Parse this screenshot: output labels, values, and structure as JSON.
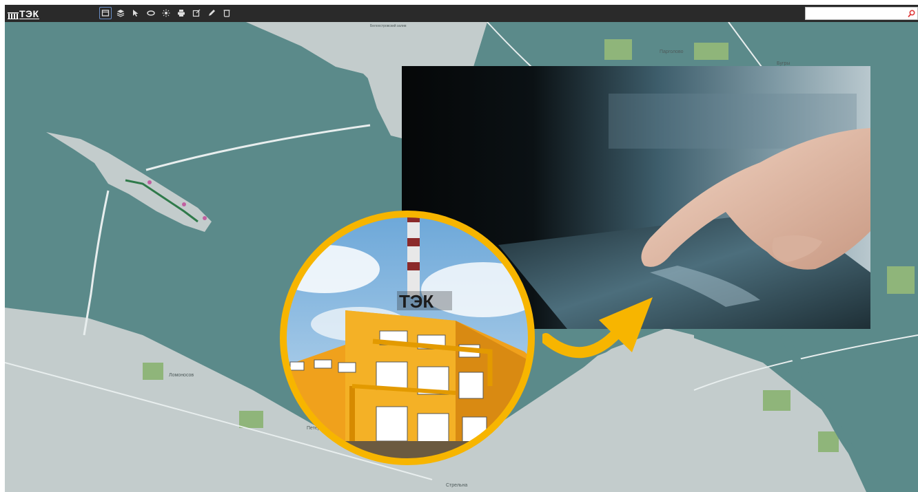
{
  "app": {
    "logo_text": "ТЭК"
  },
  "toolbar": {
    "tools": [
      {
        "name": "map-view",
        "active": true
      },
      {
        "name": "layers"
      },
      {
        "name": "select"
      },
      {
        "name": "measure"
      },
      {
        "name": "settings"
      },
      {
        "name": "print"
      },
      {
        "name": "export"
      },
      {
        "name": "draw"
      },
      {
        "name": "delete"
      }
    ]
  },
  "search": {
    "value": "",
    "placeholder": ""
  },
  "map": {
    "labels": {
      "pargolovo": "Парголово",
      "bugry": "Бугры",
      "lomonosov": "Ломоносов",
      "peterhof": "Петерг",
      "strelna": "Стрельна",
      "reservoir": "Белоостровский залив"
    },
    "colors": {
      "water": "#5b8a8a",
      "land": "#c3cccc",
      "park": "#8fb57a"
    }
  },
  "overlay": {
    "building_sign": "ТЭК",
    "accent_color": "#f7b500"
  }
}
